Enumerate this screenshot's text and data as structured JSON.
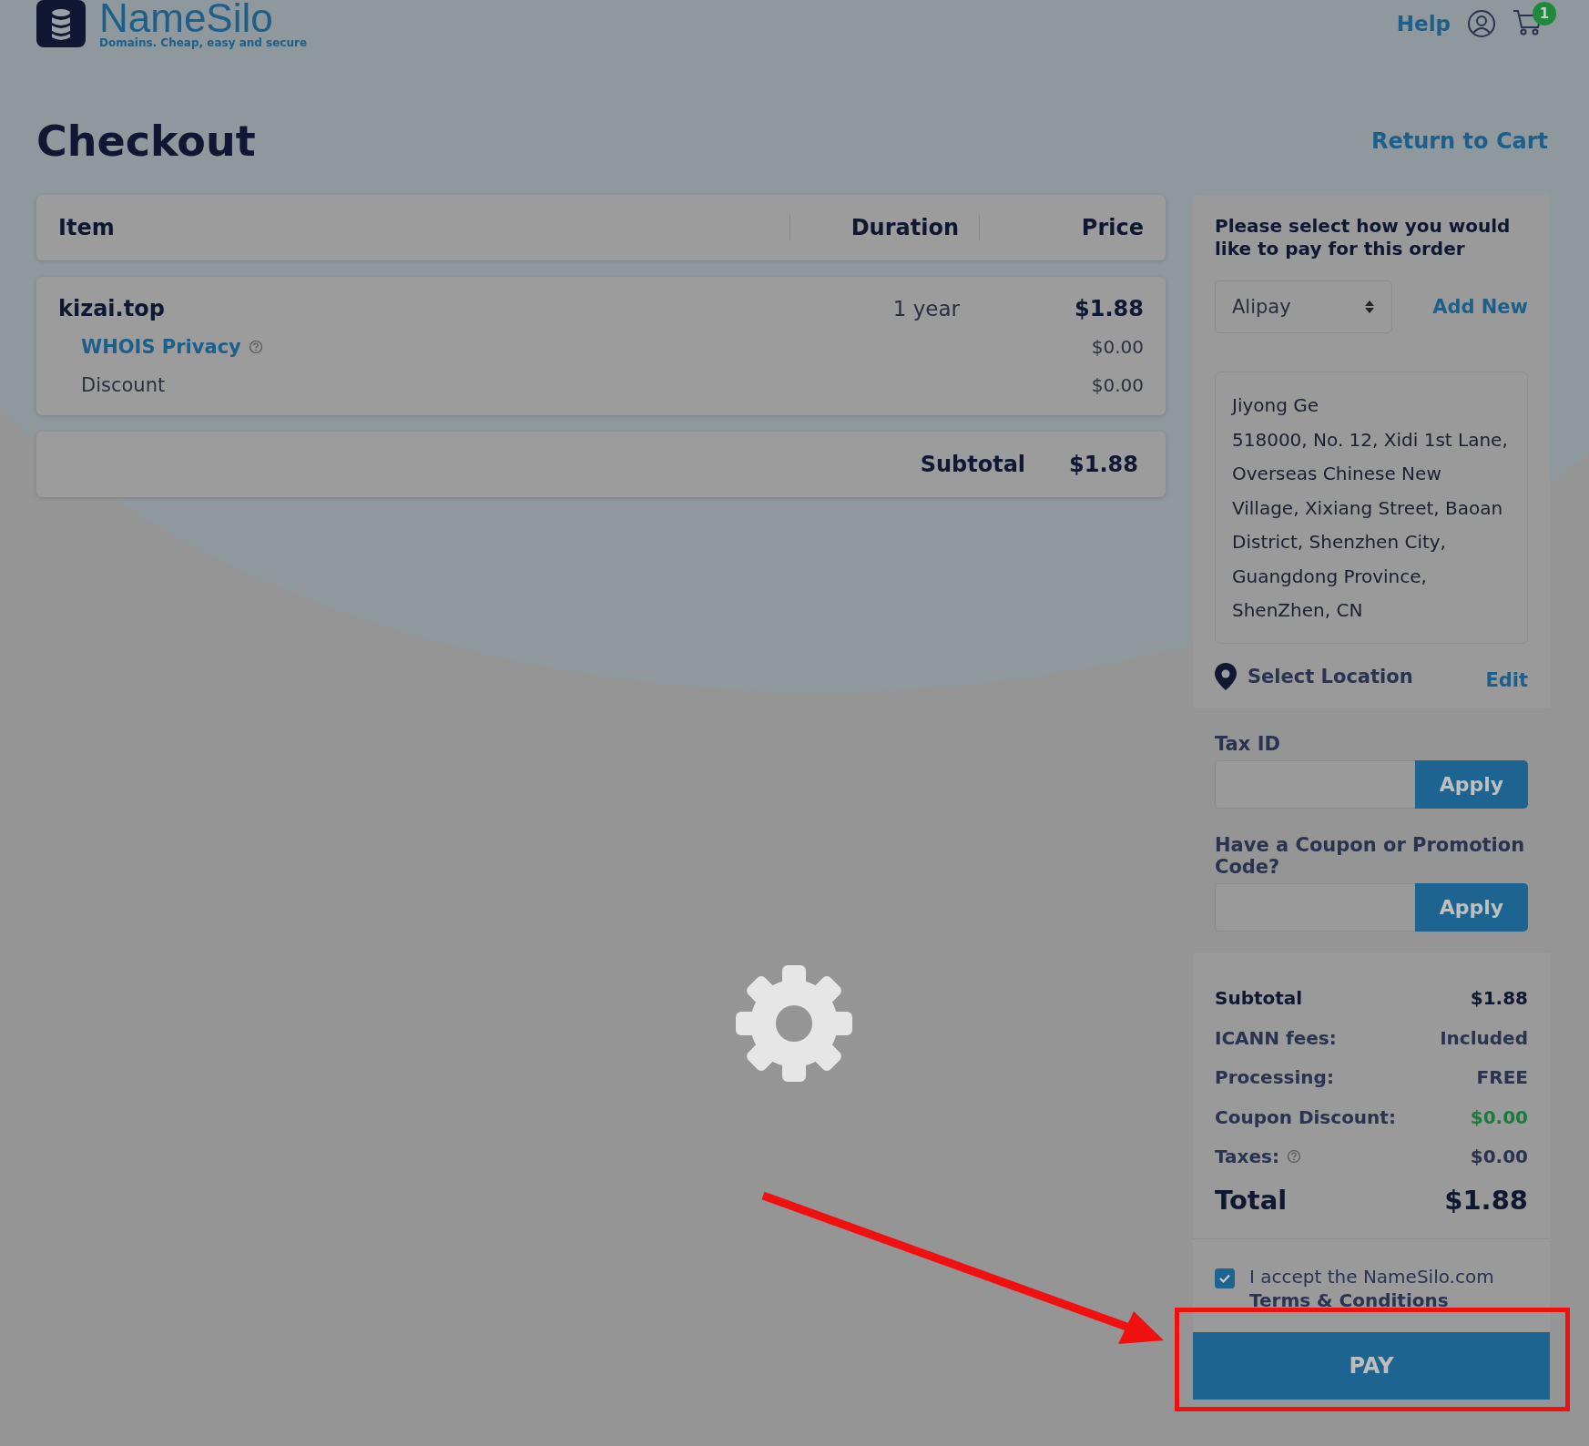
{
  "header": {
    "logo_name": "NameSilo",
    "logo_tagline": "Domains. Cheap, easy and secure",
    "help_link": "Help",
    "cart_count": "1"
  },
  "page": {
    "title": "Checkout",
    "return_link": "Return to Cart"
  },
  "order_table": {
    "columns": [
      "Item",
      "Duration",
      "Price"
    ],
    "rows": [
      {
        "kind": "item",
        "label": "kizai.top",
        "duration": "1 year",
        "price": "$1.88"
      },
      {
        "kind": "addon",
        "label": "WHOIS Privacy",
        "price": "$0.00",
        "help": true
      },
      {
        "kind": "plain",
        "label": "Discount",
        "price": "$0.00"
      }
    ],
    "subtotal_label": "Subtotal",
    "subtotal_value": "$1.88"
  },
  "payment": {
    "heading": "Please select how you would like to pay for this order",
    "method": "Alipay",
    "add_new": "Add New",
    "address": [
      "Jiyong Ge",
      "518000, No. 12, Xidi 1st Lane, Overseas Chinese New Village, Xixiang Street, Baoan District, Shenzhen City, Guangdong Province, ShenZhen, CN"
    ],
    "location_label": "Select Location",
    "edit_link": "Edit",
    "tax_id_label": "Tax ID",
    "tax_apply": "Apply",
    "coupon_label": "Have a Coupon or Promotion Code?",
    "coupon_apply": "Apply",
    "summary": [
      {
        "kind": "strong",
        "label": "Subtotal",
        "value": "$1.88"
      },
      {
        "kind": "normal",
        "label": "ICANN fees:",
        "value": "Included"
      },
      {
        "kind": "normal",
        "label": "Processing:",
        "value": "FREE"
      },
      {
        "kind": "discount",
        "label": "Coupon Discount:",
        "value": "$0.00"
      },
      {
        "kind": "help",
        "label": "Taxes:",
        "value": "$0.00"
      },
      {
        "kind": "total",
        "label": "Total",
        "value": "$1.88"
      }
    ],
    "terms": {
      "checked": true,
      "text": "I accept the NameSilo.com",
      "link": "Terms & Conditions"
    },
    "pay_button": "PAY"
  },
  "loading": true
}
